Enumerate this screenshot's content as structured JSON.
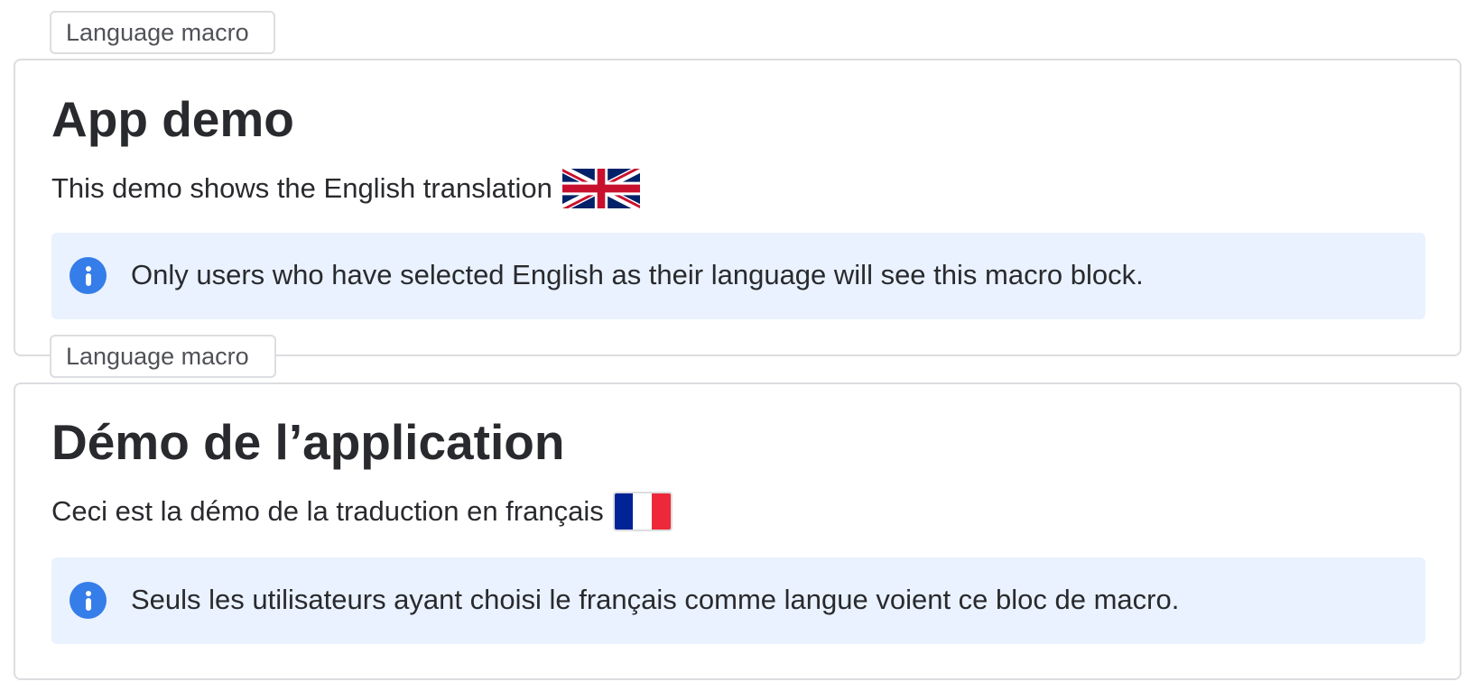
{
  "macros": [
    {
      "tab_label": "Language macro",
      "heading": "App demo",
      "description": "This demo shows the English translation",
      "flag_icon": "uk-flag-icon",
      "info_icon": "info-icon",
      "info_text": "Only users who have selected English as their language will see this macro block."
    },
    {
      "tab_label": "Language macro",
      "heading": "Démo de l’application",
      "description": "Ceci est la démo de la traduction en français",
      "flag_icon": "france-flag-icon",
      "info_icon": "info-icon",
      "info_text": "Seuls les utilisateurs ayant choisi le français comme langue voient ce bloc de macro."
    }
  ],
  "colors": {
    "info_panel_bg": "#e9f2fe",
    "info_icon": "#357de8",
    "border": "#dcdde0",
    "text": "#292a2e",
    "uk_blue": "#012169",
    "uk_red": "#c8102e",
    "fr_blue": "#002395",
    "fr_red": "#ed2939"
  }
}
